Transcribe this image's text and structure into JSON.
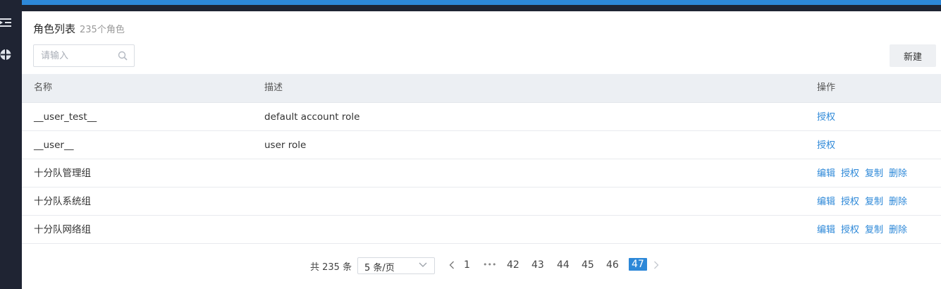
{
  "header": {
    "title": "角色列表",
    "count_text": "235个角色"
  },
  "search": {
    "placeholder": "请输入",
    "value": ""
  },
  "toolbar": {
    "new_label": "新建"
  },
  "table": {
    "columns": [
      "名称",
      "描述",
      "操作"
    ],
    "rows": [
      {
        "name": "__user_test__",
        "desc": "default account role",
        "actions": [
          "授权"
        ]
      },
      {
        "name": "__user__",
        "desc": "user role",
        "actions": [
          "授权"
        ]
      },
      {
        "name": "十分队管理组",
        "desc": "",
        "actions": [
          "编辑",
          "授权",
          "复制",
          "删除"
        ]
      },
      {
        "name": "十分队系统组",
        "desc": "",
        "actions": [
          "编辑",
          "授权",
          "复制",
          "删除"
        ]
      },
      {
        "name": "十分队网络组",
        "desc": "",
        "actions": [
          "编辑",
          "授权",
          "复制",
          "删除"
        ]
      }
    ]
  },
  "pagination": {
    "total_text": "共 235 条",
    "page_size": "5 条/页",
    "pages": [
      "1",
      "•••",
      "42",
      "43",
      "44",
      "45",
      "46",
      "47"
    ],
    "current": "47"
  },
  "colors": {
    "accent": "#2d88d8",
    "sidebar": "#1f2433",
    "header_bg": "#eceff3"
  }
}
